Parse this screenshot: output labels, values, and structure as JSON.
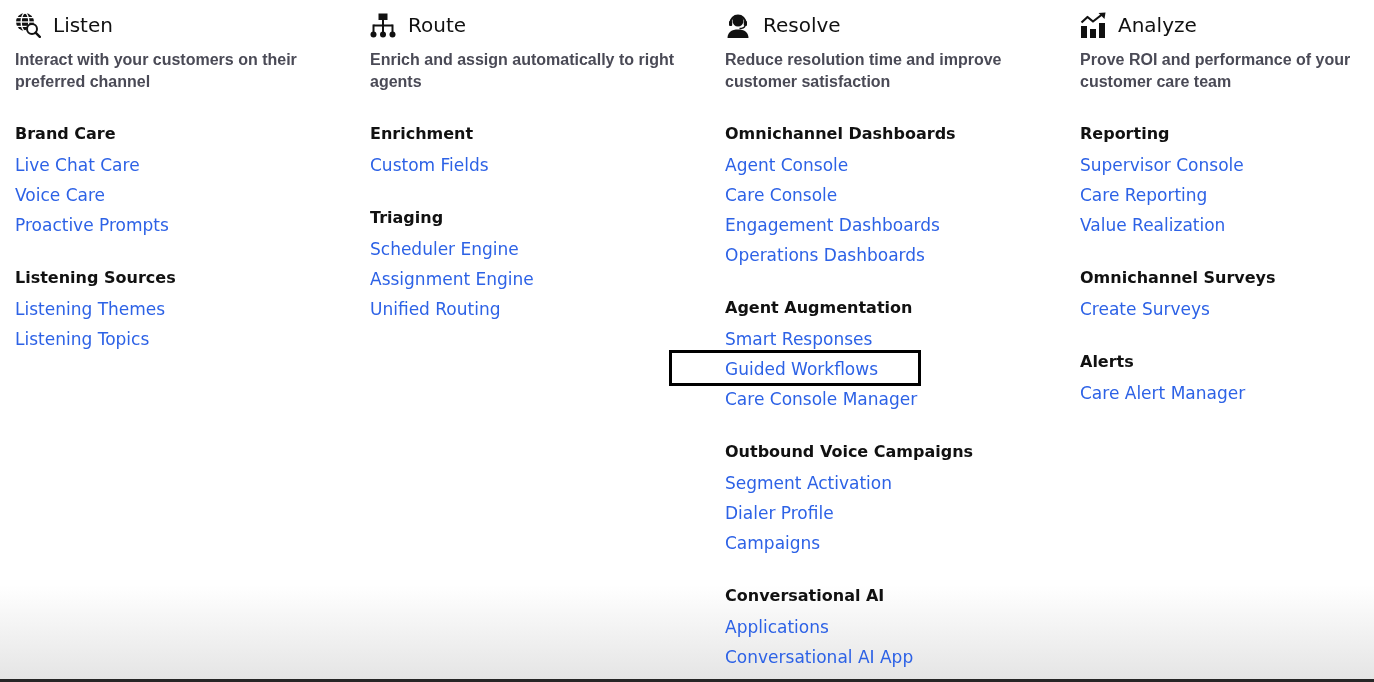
{
  "columns": [
    {
      "title": "Listen",
      "description": "Interact with your customers on their preferred channel",
      "groups": [
        {
          "heading": "Brand Care",
          "links": [
            {
              "label": "Live Chat Care",
              "highlighted": false
            },
            {
              "label": "Voice Care",
              "highlighted": false
            },
            {
              "label": "Proactive Prompts",
              "highlighted": false
            }
          ]
        },
        {
          "heading": "Listening Sources",
          "links": [
            {
              "label": "Listening Themes",
              "highlighted": false
            },
            {
              "label": "Listening Topics",
              "highlighted": false
            }
          ]
        }
      ]
    },
    {
      "title": "Route",
      "description": "Enrich and assign automatically to right agents",
      "groups": [
        {
          "heading": "Enrichment",
          "links": [
            {
              "label": "Custom Fields",
              "highlighted": false
            }
          ]
        },
        {
          "heading": "Triaging",
          "links": [
            {
              "label": "Scheduler Engine",
              "highlighted": false
            },
            {
              "label": "Assignment Engine",
              "highlighted": false
            },
            {
              "label": "Unified Routing",
              "highlighted": false
            }
          ]
        }
      ]
    },
    {
      "title": "Resolve",
      "description": "Reduce resolution time and improve customer satisfaction",
      "groups": [
        {
          "heading": "Omnichannel Dashboards",
          "links": [
            {
              "label": "Agent Console",
              "highlighted": false
            },
            {
              "label": "Care Console",
              "highlighted": false
            },
            {
              "label": "Engagement Dashboards",
              "highlighted": false
            },
            {
              "label": "Operations Dashboards",
              "highlighted": false
            }
          ]
        },
        {
          "heading": "Agent Augmentation",
          "links": [
            {
              "label": "Smart Responses",
              "highlighted": false
            },
            {
              "label": "Guided Workflows",
              "highlighted": true
            },
            {
              "label": "Care Console Manager",
              "highlighted": false
            }
          ]
        },
        {
          "heading": "Outbound Voice Campaigns",
          "links": [
            {
              "label": "Segment Activation",
              "highlighted": false
            },
            {
              "label": "Dialer Profile",
              "highlighted": false
            },
            {
              "label": "Campaigns",
              "highlighted": false
            }
          ]
        },
        {
          "heading": "Conversational AI",
          "links": [
            {
              "label": "Applications",
              "highlighted": false
            },
            {
              "label": "Conversational AI App",
              "highlighted": false
            }
          ]
        }
      ]
    },
    {
      "title": "Analyze",
      "description": "Prove ROI and performance of your customer care team",
      "groups": [
        {
          "heading": "Reporting",
          "links": [
            {
              "label": "Supervisor Console",
              "highlighted": false
            },
            {
              "label": "Care Reporting",
              "highlighted": false
            },
            {
              "label": "Value Realization",
              "highlighted": false
            }
          ]
        },
        {
          "heading": "Omnichannel Surveys",
          "links": [
            {
              "label": "Create Surveys",
              "highlighted": false
            }
          ]
        },
        {
          "heading": "Alerts",
          "links": [
            {
              "label": "Care Alert Manager",
              "highlighted": false
            }
          ]
        }
      ]
    }
  ]
}
